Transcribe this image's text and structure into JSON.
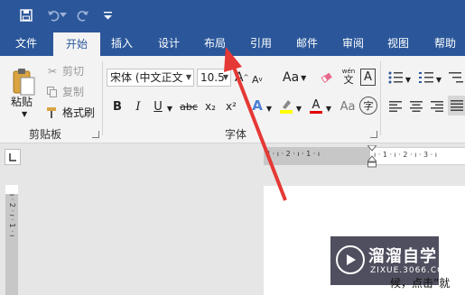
{
  "tabs": [
    "文件",
    "开始",
    "插入",
    "设计",
    "布局",
    "引用",
    "邮件",
    "审阅",
    "视图",
    "帮助"
  ],
  "active_tab": "开始",
  "clipboard": {
    "paste_label": "粘贴",
    "cut_label": "剪切",
    "copy_label": "复制",
    "format_painter_label": "格式刷",
    "group_label": "剪贴板"
  },
  "font": {
    "font_name": "宋体 (中文正文",
    "font_size": "10.5",
    "case_label": "Aa",
    "phonetic_glyph": "wén",
    "border_char": "A",
    "bold": "B",
    "italic": "I",
    "underline": "U",
    "strike": "abc",
    "subscript": "x₂",
    "superscript": "x²",
    "text_effect": "A",
    "font_color": "A",
    "circle_char": "字",
    "group_label": "字体"
  },
  "ruler": {
    "h_marks": "3 · ı · 2 · ı · 1 · ı",
    "h_marks_right": "ı · 1 · ı · 2 · ı · 3 · ı",
    "v_marks": "ı · 2 · ı · 1 · ı"
  },
  "watermark": {
    "title": "溜溜自学",
    "url": "ZIXUE.3066.COM",
    "tail_text": "候，点击”就"
  },
  "colors": {
    "brand": "#2b579a",
    "highlight": "#ffff00",
    "font_color": "#e00000",
    "arrow": "#e53935"
  }
}
